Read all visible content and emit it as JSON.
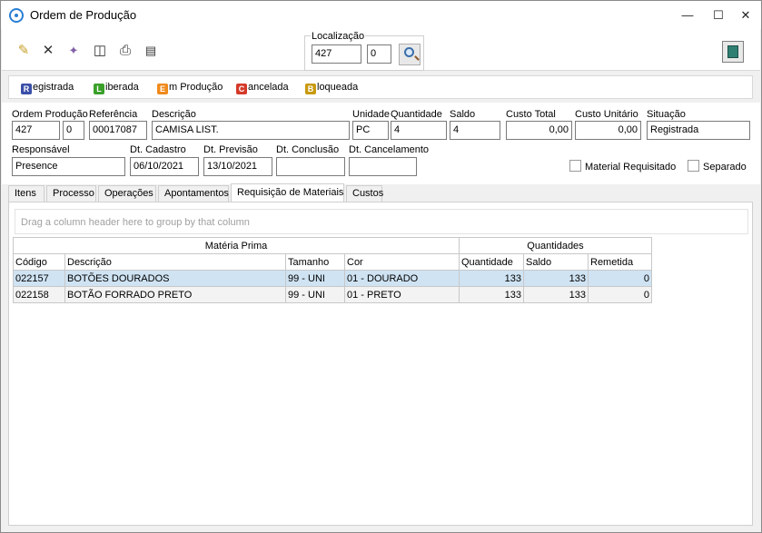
{
  "window": {
    "title": "Ordem de Produção"
  },
  "colors": {
    "registrada": "#3a4fa8",
    "liberada": "#3aa02a",
    "em_producao": "#f08a1c",
    "cancelada": "#d43a2a",
    "bloqueada": "#c89a10",
    "selected_row": "#cfe3f3"
  },
  "toolbar": {
    "icons": [
      "new-record-icon",
      "delete-icon",
      "magic-wand-icon",
      "print-preview-icon",
      "printer-icon",
      "report-icon"
    ],
    "localizacao": {
      "label": "Localização",
      "value1": "427",
      "value2": "0"
    },
    "exit_icon": "exit-icon"
  },
  "status": {
    "registrada": {
      "letter": "R",
      "rest": "egistrada"
    },
    "liberada": {
      "letter": "L",
      "rest": "iberada"
    },
    "em_producao": {
      "letter": "E",
      "rest": "m Produção"
    },
    "cancelada": {
      "letter": "C",
      "rest": "ancelada"
    },
    "bloqueada": {
      "letter": "B",
      "rest": "loqueada"
    }
  },
  "fields": {
    "ordem_producao": {
      "label": "Ordem Produção",
      "value": "427",
      "value2": "0"
    },
    "referencia": {
      "label": "Referência",
      "value": "00017087"
    },
    "descricao": {
      "label": "Descrição",
      "value": "CAMISA LIST."
    },
    "unidade": {
      "label": "Unidade",
      "value": "PC"
    },
    "quantidade": {
      "label": "Quantidade",
      "value": "4"
    },
    "saldo": {
      "label": "Saldo",
      "value": "4"
    },
    "custo_total": {
      "label": "Custo Total",
      "value": "0,00"
    },
    "custo_unitario": {
      "label": "Custo Unitário",
      "value": "0,00"
    },
    "situacao": {
      "label": "Situação",
      "value": "Registrada"
    },
    "responsavel": {
      "label": "Responsável",
      "value": "Presence"
    },
    "dt_cadastro": {
      "label": "Dt. Cadastro",
      "value": "06/10/2021"
    },
    "dt_previsao": {
      "label": "Dt. Previsão",
      "value": "13/10/2021"
    },
    "dt_conclusao": {
      "label": "Dt. Conclusão",
      "value": ""
    },
    "dt_cancelamento": {
      "label": "Dt. Cancelamento",
      "value": ""
    },
    "material_requisitado": {
      "label": "Material Requisitado",
      "checked": false
    },
    "separado": {
      "label": "Separado",
      "checked": false
    }
  },
  "tabs": [
    "Itens",
    "Processo",
    "Operações",
    "Apontamentos",
    "Requisição de Materiais",
    "Custos"
  ],
  "active_tab": "Requisição de Materiais",
  "grid": {
    "group_hint": "Drag a column header here to group by that column",
    "bands": [
      "Matéria Prima",
      "Quantidades"
    ],
    "columns": [
      "Código",
      "Descrição",
      "Tamanho",
      "Cor",
      "Quantidade",
      "Saldo",
      "Remetida"
    ],
    "rows": [
      [
        "022157",
        "BOTÕES DOURADOS",
        "99 - UNI",
        "01 - DOURADO",
        "133",
        "133",
        "0"
      ],
      [
        "022158",
        "BOTÃO FORRADO PRETO",
        "99 - UNI",
        "01 - PRETO",
        "133",
        "133",
        "0"
      ]
    ]
  }
}
